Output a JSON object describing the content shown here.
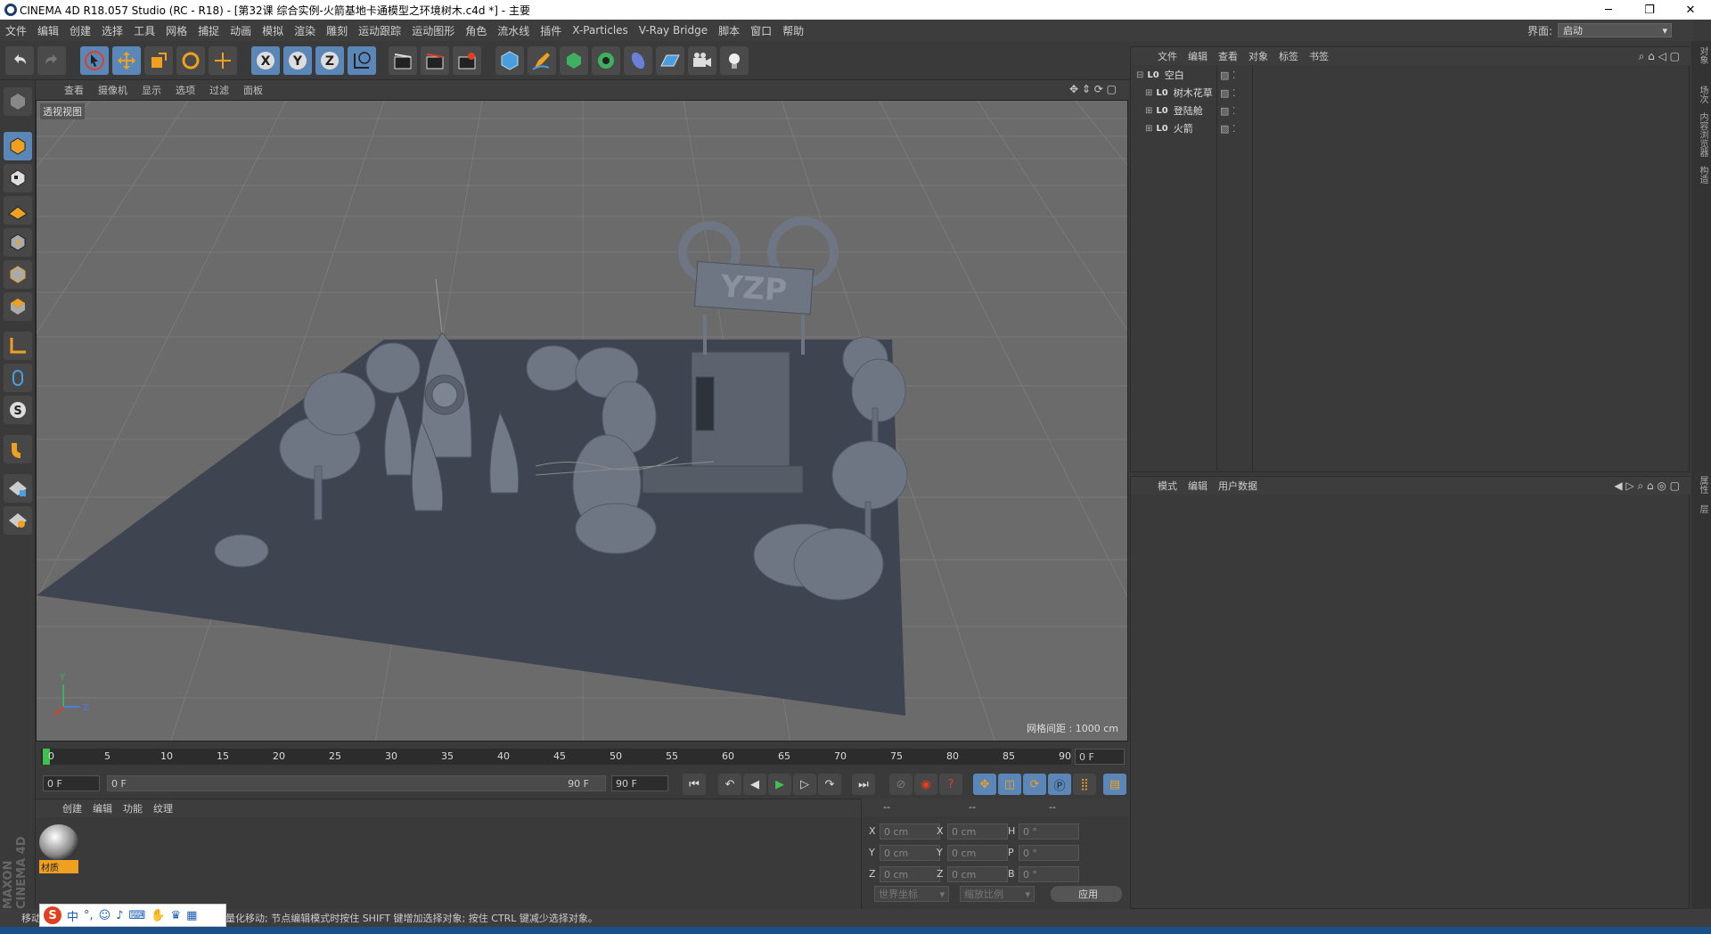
{
  "window": {
    "title": "CINEMA 4D R18.057 Studio (RC - R18) - [第32课   综合实例-火箭基地卡通模型之环境树木.c4d *] - 主要"
  },
  "menu": [
    "文件",
    "编辑",
    "创建",
    "选择",
    "工具",
    "网格",
    "捕捉",
    "动画",
    "模拟",
    "渲染",
    "雕刻",
    "运动跟踪",
    "运动图形",
    "角色",
    "流水线",
    "插件",
    "X-Particles",
    "V-Ray Bridge",
    "脚本",
    "窗口",
    "帮助"
  ],
  "layout": {
    "label": "界面:",
    "value": "启动"
  },
  "viewport": {
    "menu": [
      "查看",
      "摄像机",
      "显示",
      "选项",
      "过滤",
      "面板"
    ],
    "label": "透视视图",
    "grid_info": "网格间距 : 1000 cm",
    "sign_text": "YZP"
  },
  "timeline": {
    "ticks": [
      "0",
      "5",
      "10",
      "15",
      "20",
      "25",
      "30",
      "35",
      "40",
      "45",
      "50",
      "55",
      "60",
      "65",
      "70",
      "75",
      "80",
      "85",
      "90"
    ],
    "current": "0 F"
  },
  "transport": {
    "start": "0 F",
    "range_start": "0 F",
    "range_end": "90 F",
    "end": "90 F"
  },
  "material": {
    "menu": [
      "创建",
      "编辑",
      "功能",
      "纹理"
    ],
    "item": "材质"
  },
  "coords": {
    "headers": [
      "--",
      "--",
      "--"
    ],
    "rows": [
      {
        "a": "X",
        "av": "0 cm",
        "b": "X",
        "bv": "0 cm",
        "c": "H",
        "cv": "0 °"
      },
      {
        "a": "Y",
        "av": "0 cm",
        "b": "Y",
        "bv": "0 cm",
        "c": "P",
        "cv": "0 °"
      },
      {
        "a": "Z",
        "av": "0 cm",
        "b": "Z",
        "bv": "0 cm",
        "c": "B",
        "cv": "0 °"
      }
    ],
    "mode1": "世界坐标",
    "mode2": "缩放比例",
    "apply": "应用"
  },
  "objects": {
    "menu": [
      "文件",
      "编辑",
      "查看",
      "对象",
      "标签",
      "书签"
    ],
    "items": [
      {
        "name": "空白",
        "level": 0
      },
      {
        "name": "树木花草",
        "level": 1
      },
      {
        "name": "登陆舱",
        "level": 1
      },
      {
        "name": "火箭",
        "level": 1
      }
    ]
  },
  "attributes": {
    "menu": [
      "模式",
      "编辑",
      "用户数据"
    ]
  },
  "right_tabs": [
    "对象",
    "场次",
    "内容浏览器",
    "构造",
    "属性",
    "层"
  ],
  "status": {
    "mode": "移动",
    "text": "键量化移动; 节点编辑模式时按住 SHIFT 键增加选择对象; 按住 CTRL 键减少选择对象。"
  },
  "ime": {
    "label": "中"
  },
  "brand": "MAXON CINEMA 4D",
  "colors": {
    "accent": "#5a86b8",
    "orange": "#f0a020"
  }
}
